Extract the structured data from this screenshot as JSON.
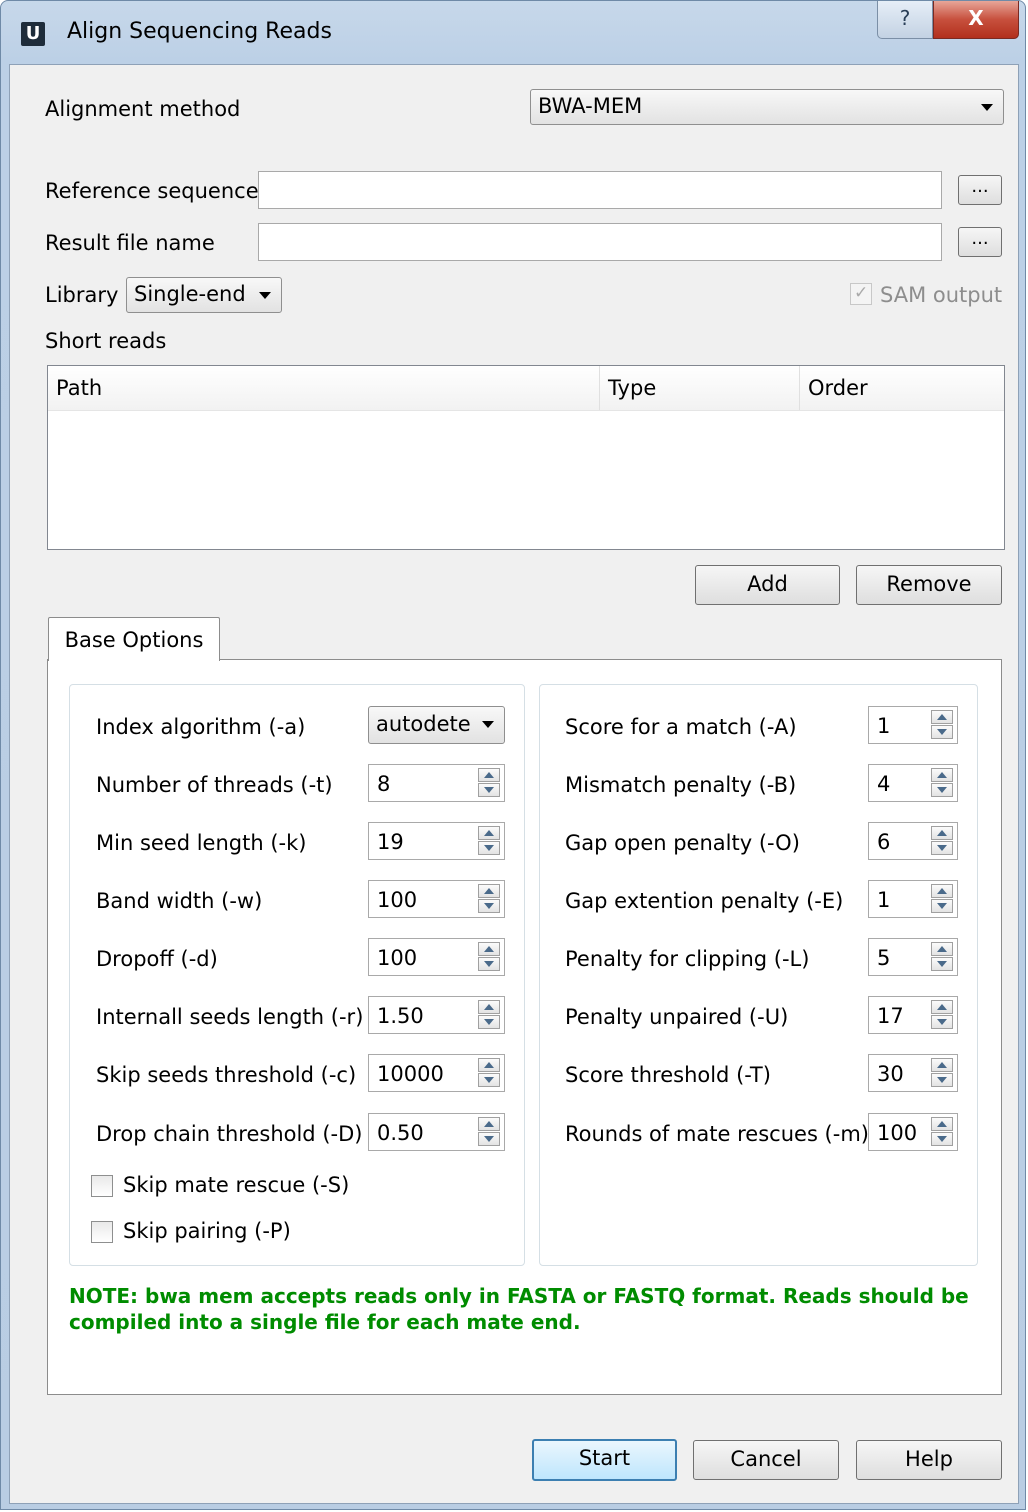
{
  "window": {
    "title": "Align Sequencing Reads",
    "app_icon": "U",
    "help_glyph": "?",
    "close_glyph": "X"
  },
  "alignment_method": {
    "label": "Alignment method",
    "value": "BWA-MEM"
  },
  "reference_sequence": {
    "label": "Reference sequence",
    "value": "",
    "browse_label": "..."
  },
  "result_file": {
    "label": "Result file name",
    "value": "",
    "browse_label": "..."
  },
  "library": {
    "label": "Library",
    "value": "Single-end"
  },
  "sam_output": {
    "label": "SAM output",
    "checked": true,
    "enabled": false
  },
  "short_reads": {
    "label": "Short reads",
    "columns": [
      "Path",
      "Type",
      "Order"
    ],
    "rows": []
  },
  "reads_buttons": {
    "add": "Add",
    "remove": "Remove"
  },
  "tabs": [
    {
      "label": "Base Options",
      "active": true
    }
  ],
  "left_options": [
    {
      "label": "Index algorithm (-a)",
      "value": "autodete",
      "kind": "combo"
    },
    {
      "label": "Number of threads (-t)",
      "value": "8",
      "kind": "spin"
    },
    {
      "label": "Min seed length (-k)",
      "value": "19",
      "kind": "spin"
    },
    {
      "label": "Band width (-w)",
      "value": "100",
      "kind": "spin"
    },
    {
      "label": "Dropoff (-d)",
      "value": "100",
      "kind": "spin"
    },
    {
      "label": "Internall seeds length (-r)",
      "value": "1.50",
      "kind": "spin"
    },
    {
      "label": "Skip seeds threshold (-c)",
      "value": "10000",
      "kind": "spin"
    },
    {
      "label": "Drop chain threshold (-D)",
      "value": "0.50",
      "kind": "spin"
    }
  ],
  "checkboxes": [
    {
      "label": "Skip mate rescue (-S)",
      "checked": false
    },
    {
      "label": "Skip pairing (-P)",
      "checked": false
    }
  ],
  "right_options": [
    {
      "label": "Score for a match (-A)",
      "value": "1"
    },
    {
      "label": "Mismatch penalty (-B)",
      "value": "4"
    },
    {
      "label": "Gap open penalty (-O)",
      "value": "6"
    },
    {
      "label": "Gap extention penalty (-E)",
      "value": "1"
    },
    {
      "label": "Penalty for clipping (-L)",
      "value": "5"
    },
    {
      "label": "Penalty unpaired (-U)",
      "value": "17"
    },
    {
      "label": "Score threshold (-T)",
      "value": "30"
    },
    {
      "label": "Rounds of mate rescues (-m)",
      "value": "100"
    }
  ],
  "note": {
    "line1": "NOTE: bwa mem accepts reads only in FASTA or FASTQ format. Reads should be",
    "line2": "compiled into a single file for each mate end.",
    "color": "#008c00"
  },
  "footer": {
    "start": "Start",
    "cancel": "Cancel",
    "help": "Help"
  },
  "icons": {
    "browse": "ellipsis-icon",
    "dropdown": "chevron-down-icon",
    "spin_up": "arrow-up-icon",
    "spin_down": "arrow-down-icon"
  }
}
